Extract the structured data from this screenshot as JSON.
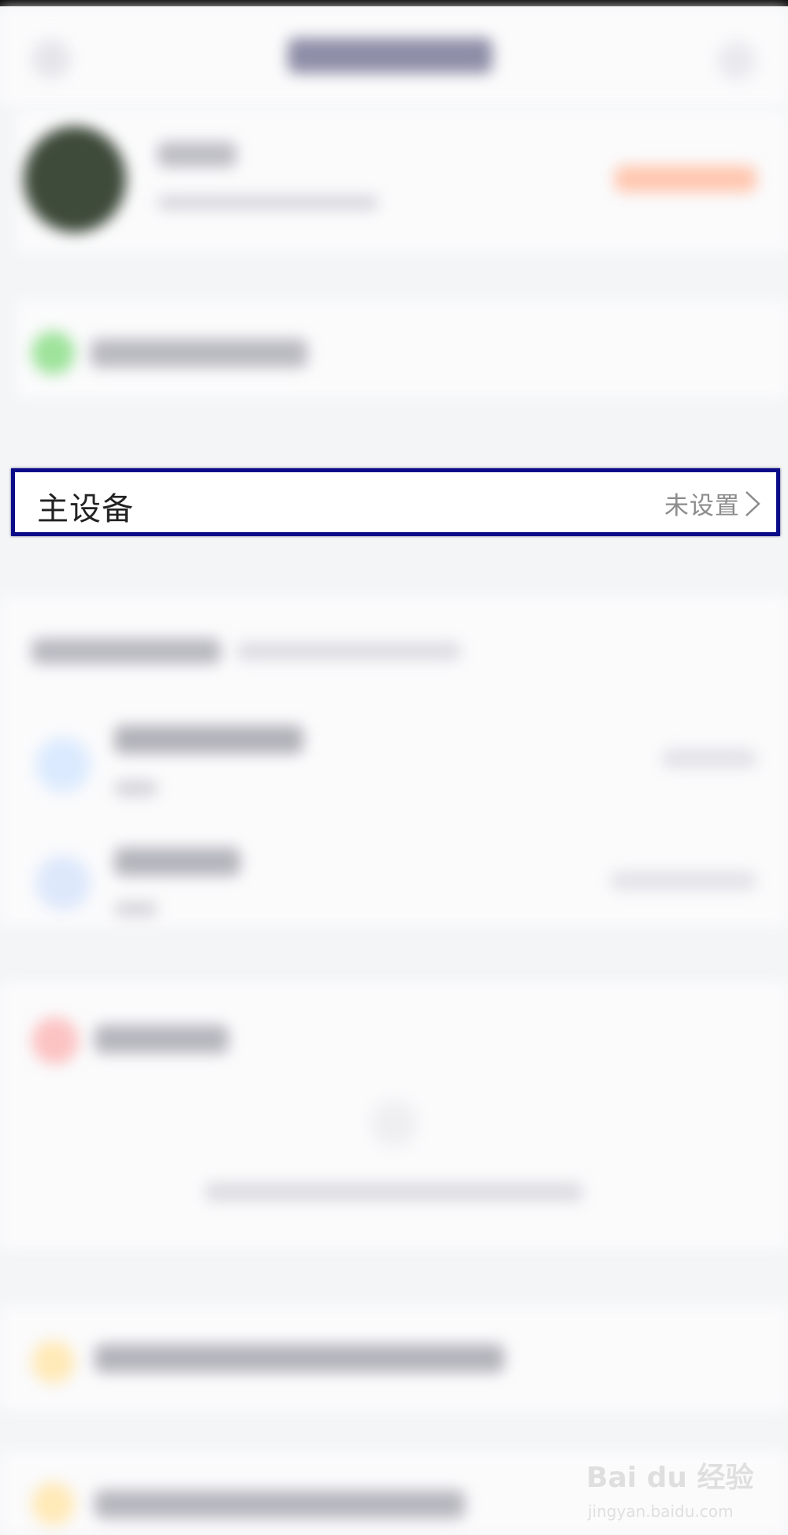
{
  "main_device": {
    "label": "主设备",
    "value": "未设置"
  },
  "watermark": {
    "logo_text": "Bai du 经验",
    "url": "jingyan.baidu.com"
  }
}
